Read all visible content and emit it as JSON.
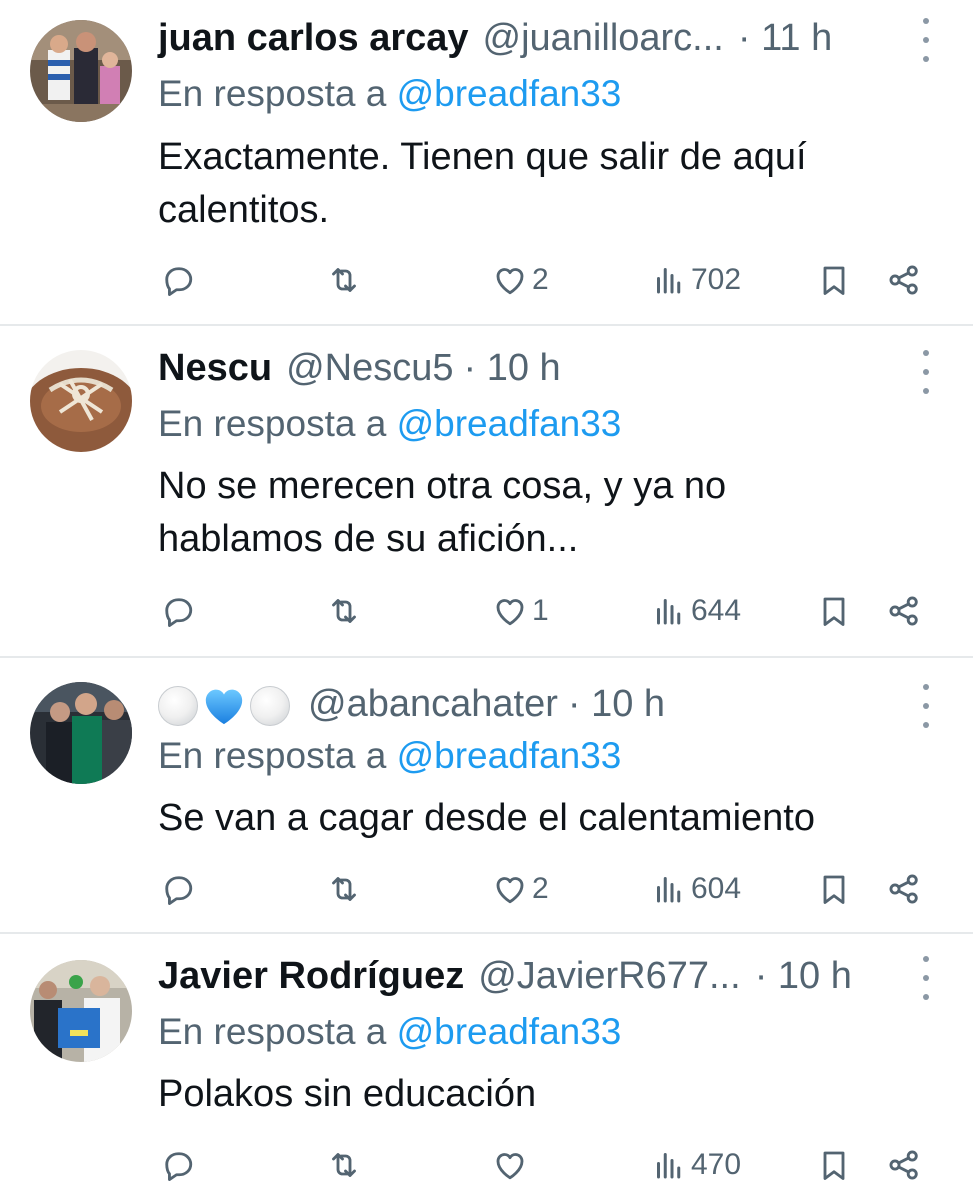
{
  "reply_prefix": "En resposta a",
  "colors": {
    "text": "#0f1419",
    "secondary": "#536471",
    "link": "#1d9bf0",
    "divider": "#e6e9eb"
  },
  "icons": [
    "reply-icon",
    "retweet-icon",
    "like-icon",
    "views-icon",
    "bookmark-icon",
    "share-icon",
    "more-options-icon"
  ],
  "tweets": [
    {
      "name": "juan carlos arcay",
      "handle": "@juanilloarc...",
      "time": "· 11 h",
      "reply_to": "@breadfan33",
      "text": "Exactamente. Tienen que salir de aquí calentitos.",
      "likes": "2",
      "views": "702"
    },
    {
      "name": "Nescu",
      "handle": "@Nescu5",
      "time": "· 10 h",
      "reply_to": "@breadfan33",
      "text": "No se merecen otra cosa, y ya no hablamos de su afición...",
      "likes": "1",
      "views": "644"
    },
    {
      "name": "⚪💙⚪",
      "handle": "@abancahater",
      "time": "· 10 h",
      "reply_to": "@breadfan33",
      "text": "Se van a cagar desde el calentamiento",
      "likes": "2",
      "views": "604"
    },
    {
      "name": "Javier Rodríguez",
      "handle": "@JavierR677...",
      "time": "· 10 h",
      "reply_to": "@breadfan33",
      "text": "Polakos sin educación",
      "likes": "",
      "views": "470"
    }
  ]
}
